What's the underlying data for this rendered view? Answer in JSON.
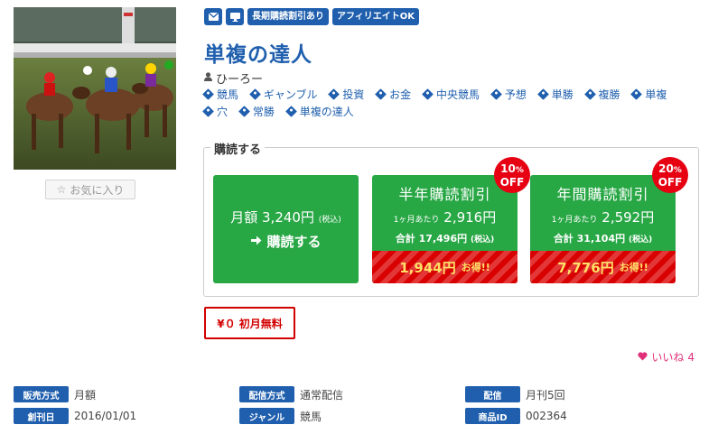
{
  "product": {
    "chips": [
      "長期購読割引あり",
      "アフィリエイトOK"
    ],
    "chip_icons": [
      "envelope-icon",
      "monitor-icon"
    ],
    "title": "単複の達人",
    "author": "ひーろー",
    "favorite_label": "お気に入り",
    "tags": [
      "競馬",
      "ギャンブル",
      "投資",
      "お金",
      "中央競馬",
      "予想",
      "単勝",
      "複勝",
      "単複",
      "穴",
      "常勝",
      "単複の達人"
    ]
  },
  "subscribe": {
    "legend": "購読する",
    "monthly": {
      "price_label": "月額 3,240円",
      "tax": "(税込)",
      "action": "購読する"
    },
    "plans": [
      {
        "title": "半年購読割引",
        "badge_pct": "10",
        "badge_unit": "%",
        "badge_off": "OFF",
        "per_label": "1ヶ月あたり",
        "per_price": "2,916円",
        "total_label": "合計",
        "total_price": "17,496円",
        "tax": "(税込)",
        "save_amount": "1,944円",
        "save_label": "お得!!"
      },
      {
        "title": "年間購読割引",
        "badge_pct": "20",
        "badge_unit": "%",
        "badge_off": "OFF",
        "per_label": "1ヶ月あたり",
        "per_price": "2,592円",
        "total_label": "合計",
        "total_price": "31,104円",
        "tax": "(税込)",
        "save_amount": "7,776円",
        "save_label": "お得!!"
      }
    ],
    "free_label": "¥０ 初月無料"
  },
  "like": {
    "label": "いいね",
    "count": "4"
  },
  "meta": [
    {
      "label": "販売方式",
      "value": "月額"
    },
    {
      "label": "配信方式",
      "value": "通常配信"
    },
    {
      "label": "配信",
      "value": "月刊5回"
    },
    {
      "label": "創刊日",
      "value": "2016/01/01"
    },
    {
      "label": "ジャンル",
      "value": "競馬"
    },
    {
      "label": "商品ID",
      "value": "002364"
    }
  ],
  "colors": {
    "brand_blue": "#1f5fae",
    "green": "#28a745",
    "red": "#d80000",
    "like_pink": "#e0307a"
  }
}
